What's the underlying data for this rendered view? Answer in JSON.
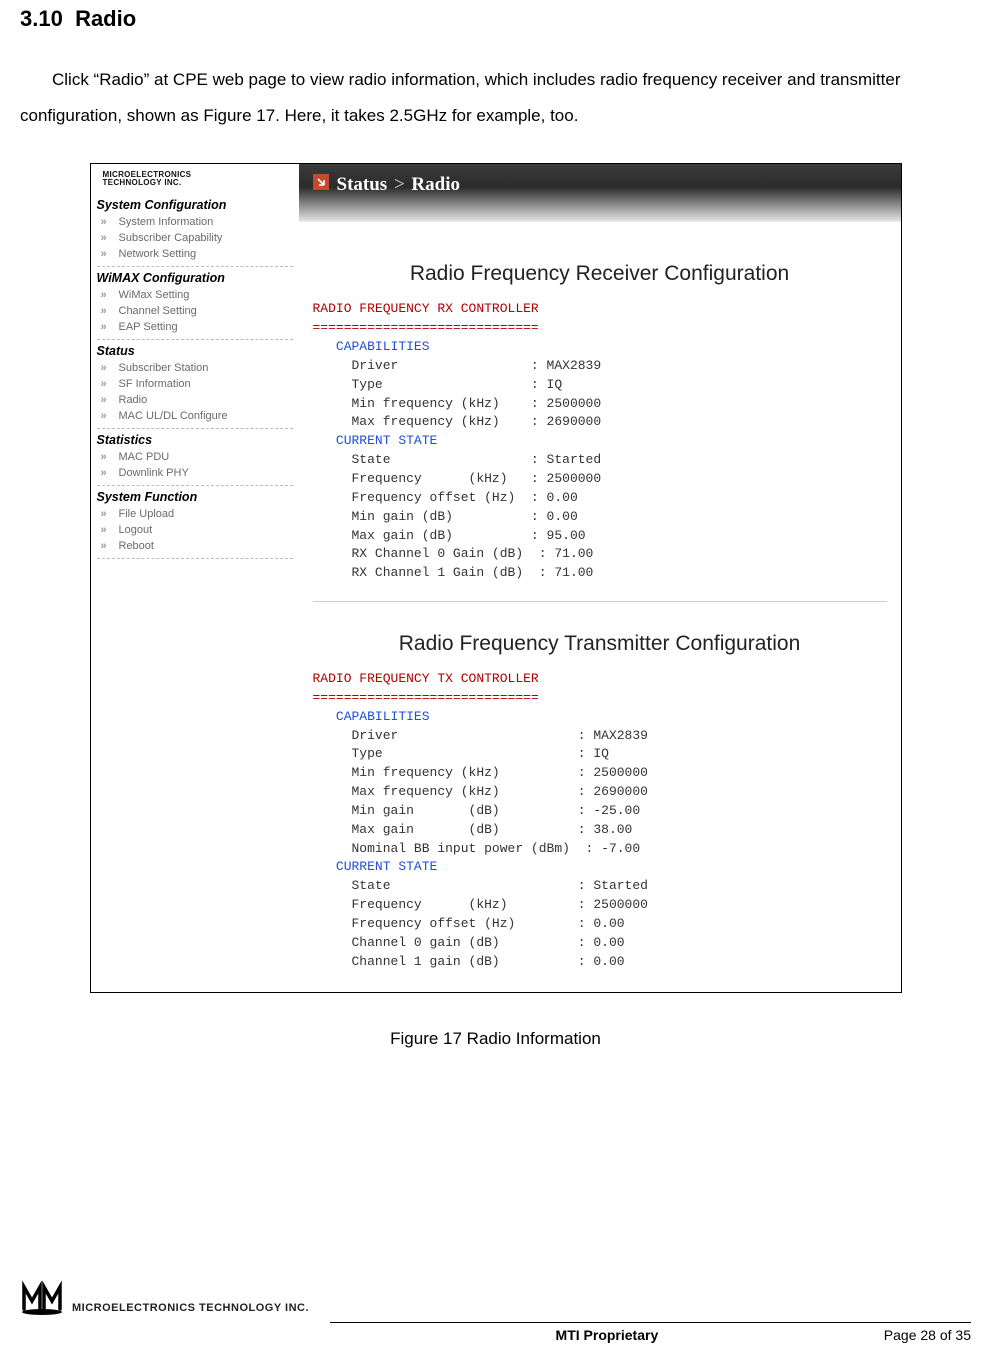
{
  "section": {
    "number": "3.10",
    "title": "Radio"
  },
  "body_text": "Click “Radio” at CPE web page to view radio information, which includes radio frequency receiver and transmitter configuration, shown as Figure 17. Here, it takes 2.5GHz for example, too.",
  "figure": {
    "sidebar": {
      "company_line1": "MICROELECTRONICS",
      "company_line2": "TECHNOLOGY INC.",
      "groups": [
        {
          "title": "System Configuration",
          "items": [
            "System Information",
            "Subscriber Capability",
            "Network Setting"
          ]
        },
        {
          "title": "WiMAX Configuration",
          "items": [
            "WiMax Setting",
            "Channel Setting",
            "EAP Setting"
          ]
        },
        {
          "title": "Status",
          "items": [
            "Subscriber Station",
            "SF Information",
            "Radio",
            "MAC UL/DL Configure"
          ]
        },
        {
          "title": "Statistics",
          "items": [
            "MAC PDU",
            "Downlink PHY"
          ]
        },
        {
          "title": "System Function",
          "items": [
            "File Upload",
            "Logout",
            "Reboot"
          ]
        }
      ]
    },
    "breadcrumb": {
      "section": "Status",
      "separator": ">",
      "page": "Radio"
    },
    "panels": [
      {
        "title": "Radio Frequency Receiver Configuration",
        "header": "RADIO FREQUENCY RX CONTROLLER",
        "rule": "=============================",
        "cap_label": "CAPABILITIES",
        "cap_rows": [
          [
            "Driver",
            "MAX2839"
          ],
          [
            "Type",
            "IQ"
          ],
          [
            "Min frequency (kHz)",
            "2500000"
          ],
          [
            "Max frequency (kHz)",
            "2690000"
          ]
        ],
        "state_label": "CURRENT STATE",
        "state_rows": [
          [
            "State",
            "Started"
          ],
          [
            "Frequency      (kHz)",
            "2500000"
          ],
          [
            "Frequency offset (Hz)",
            "0.00"
          ],
          [
            "Min gain (dB)",
            "0.00"
          ],
          [
            "Max gain (dB)",
            "95.00"
          ],
          [
            "RX Channel 0 Gain (dB)",
            "71.00"
          ],
          [
            "RX Channel 1 Gain (dB)",
            "71.00"
          ]
        ]
      },
      {
        "title": "Radio Frequency Transmitter Configuration",
        "header": "RADIO FREQUENCY TX CONTROLLER",
        "rule": "=============================",
        "cap_label": "CAPABILITIES",
        "cap_rows": [
          [
            "Driver",
            "MAX2839"
          ],
          [
            "Type",
            "IQ"
          ],
          [
            "Min frequency (kHz)",
            "2500000"
          ],
          [
            "Max frequency (kHz)",
            "2690000"
          ],
          [
            "Min gain       (dB)",
            "-25.00"
          ],
          [
            "Max gain       (dB)",
            "38.00"
          ],
          [
            "Nominal BB input power (dBm)",
            "-7.00"
          ]
        ],
        "state_label": "CURRENT STATE",
        "state_rows": [
          [
            "State",
            "Started"
          ],
          [
            "Frequency      (kHz)",
            "2500000"
          ],
          [
            "Frequency offset (Hz)",
            "0.00"
          ],
          [
            "Channel 0 gain (dB)",
            "0.00"
          ],
          [
            "Channel 1 gain (dB)",
            "0.00"
          ]
        ]
      }
    ],
    "caption": "Figure 17    Radio Information"
  },
  "footer": {
    "company": "MICROELECTRONICS TECHNOLOGY INC.",
    "proprietary": "MTI Proprietary",
    "page": "Page 28 of 35"
  },
  "colors": {
    "term_header": "#b00000",
    "term_cap": "#1f4fd6"
  }
}
